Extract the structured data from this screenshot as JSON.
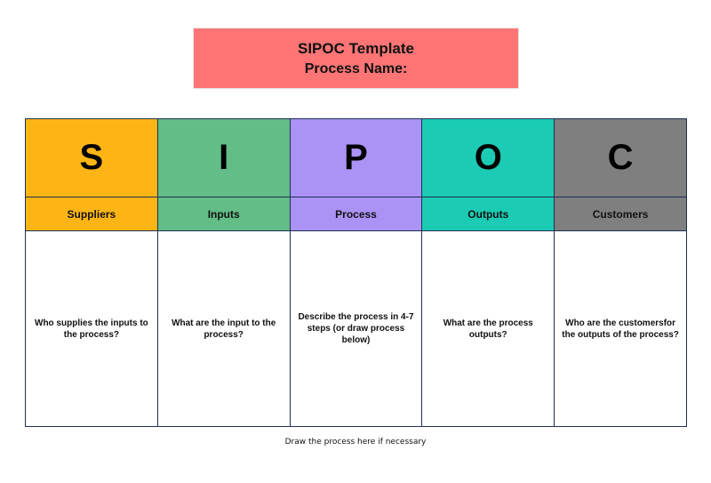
{
  "header": {
    "title": "SIPOC Template",
    "process_name_label": "Process Name:",
    "background_color": "#ff7575"
  },
  "columns": [
    {
      "letter": "S",
      "label": "Suppliers",
      "question": "Who supplies the inputs to the process?",
      "color": "#fdb515"
    },
    {
      "letter": "I",
      "label": "Inputs",
      "question": "What are the input to the process?",
      "color": "#62bd87"
    },
    {
      "letter": "P",
      "label": "Process",
      "question": "Describe the process in 4-7 steps (or draw process below)",
      "color": "#ab92f5"
    },
    {
      "letter": "O",
      "label": "Outputs",
      "question": "What are the process outputs?",
      "color": "#1ccbb4"
    },
    {
      "letter": "C",
      "label": "Customers",
      "question": "Who are the customersfor the outputs of the process?",
      "color": "#7f7f7f"
    }
  ],
  "footer": {
    "note": "Draw the process here if necessary"
  }
}
